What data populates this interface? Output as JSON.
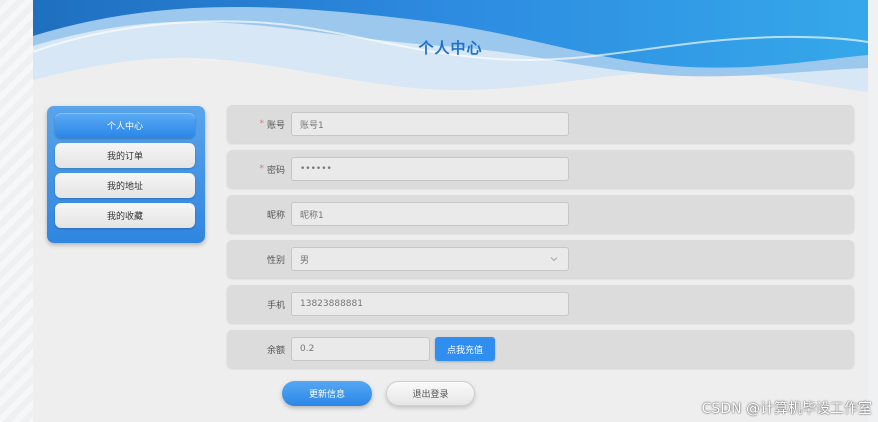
{
  "header": {
    "title": "个人中心"
  },
  "sidebar": {
    "items": [
      {
        "label": "个人中心",
        "active": true
      },
      {
        "label": "我的订单",
        "active": false
      },
      {
        "label": "我的地址",
        "active": false
      },
      {
        "label": "我的收藏",
        "active": false
      }
    ]
  },
  "form": {
    "account": {
      "label": "账号",
      "required": true,
      "value": "账号1"
    },
    "password": {
      "label": "密码",
      "required": true,
      "value": "••••••"
    },
    "nickname": {
      "label": "昵称",
      "required": false,
      "value": "昵称1"
    },
    "gender": {
      "label": "性别",
      "required": false,
      "value": "男",
      "icon": "chevron-down-icon"
    },
    "phone": {
      "label": "手机",
      "required": false,
      "value": "13823888881"
    },
    "balance": {
      "label": "余额",
      "required": false,
      "value": "0.2",
      "recharge_label": "点我充值"
    }
  },
  "actions": {
    "update_label": "更新信息",
    "logout_label": "退出登录"
  },
  "watermark": "CSDN @计算机毕设工作室",
  "colors": {
    "accent": "#2f8ef0",
    "title": "#1e73c8",
    "required": "#f56c6c",
    "header_wave": "#2a8ae0"
  }
}
